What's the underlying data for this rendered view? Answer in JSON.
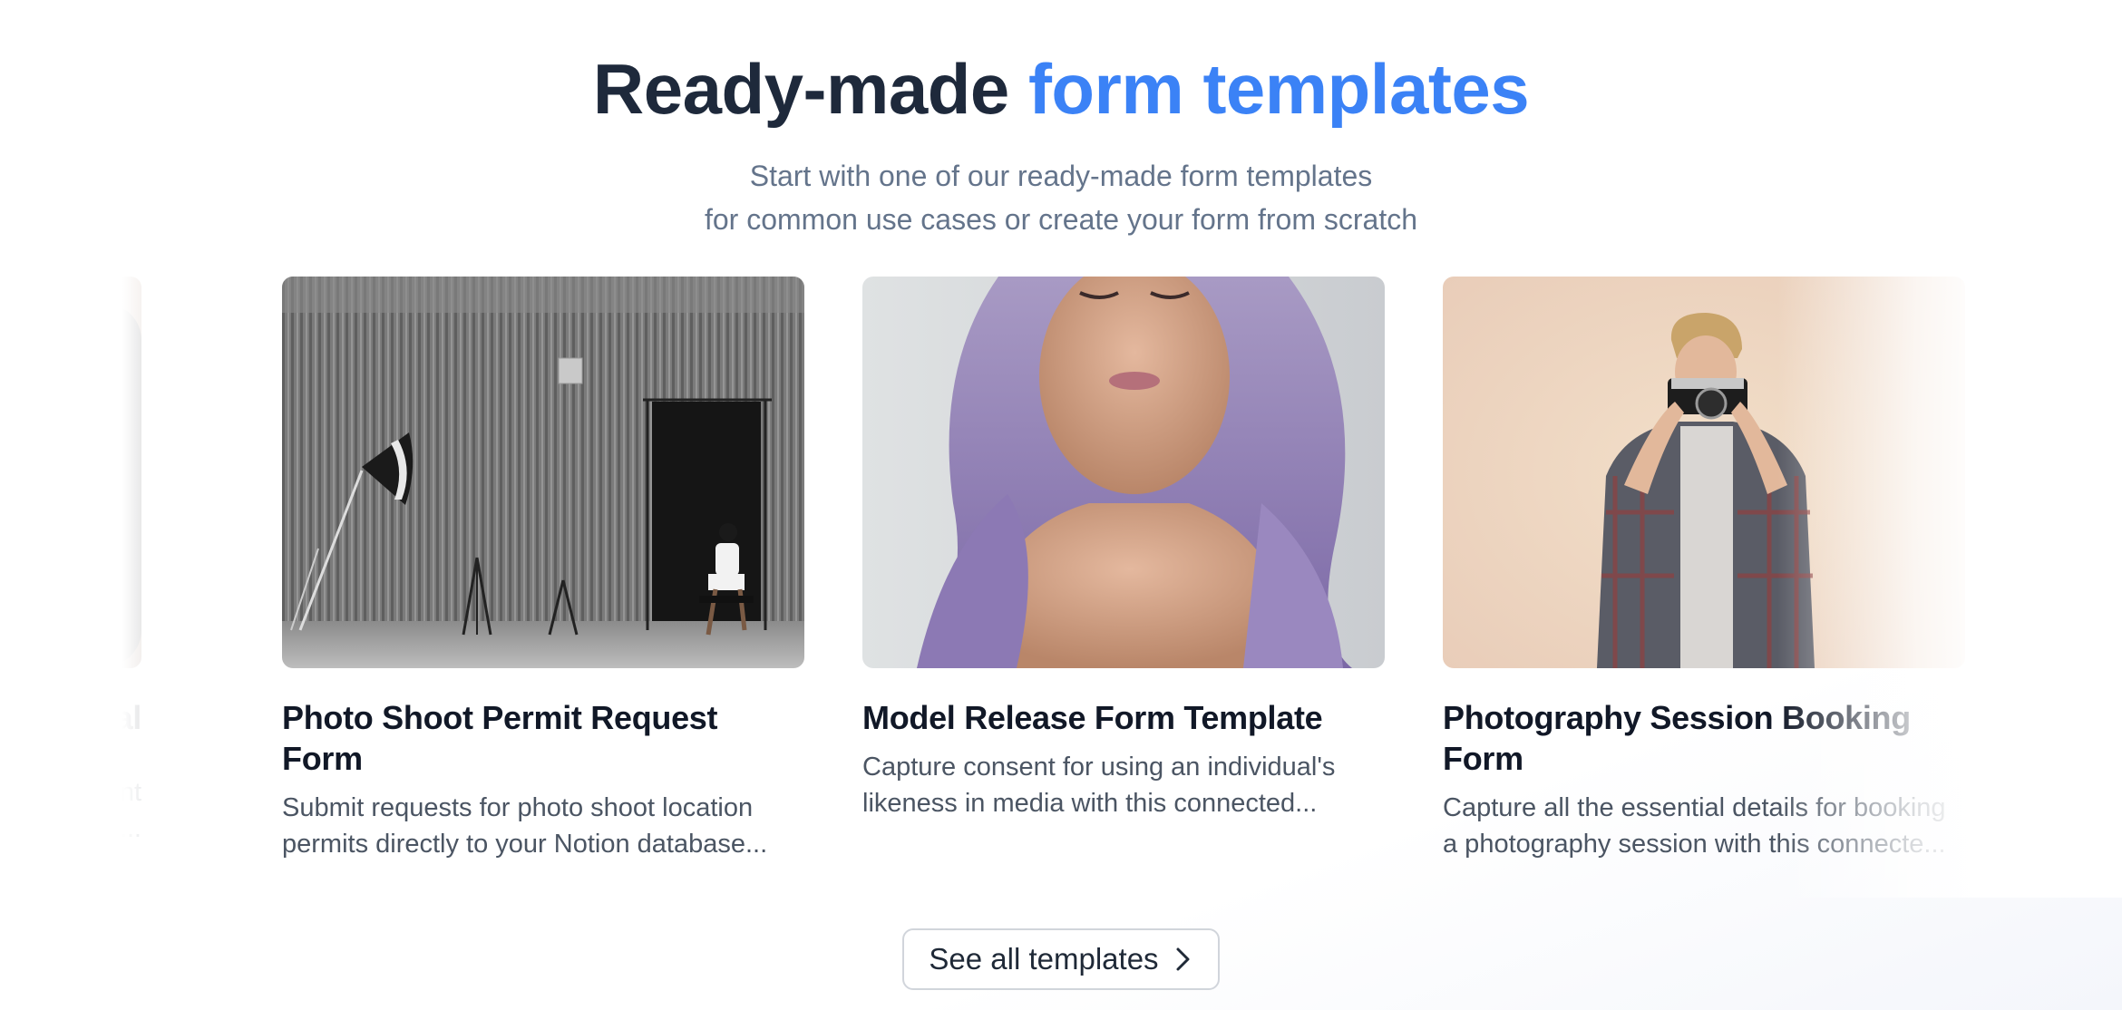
{
  "header": {
    "title_part1": "Ready-made ",
    "title_accent": "form templates",
    "subtitle_line1": "Start with one of our ready-made form templates",
    "subtitle_line2": "for common use cases or create your form from scratch"
  },
  "colors": {
    "accent": "#3b82f6",
    "heading": "#1e293b",
    "subtitle": "#64748b"
  },
  "cards": [
    {
      "title": "tal",
      "desc_line1": "nt",
      "desc_line2": "n...",
      "image": "camera-closeup"
    },
    {
      "title": "Photo Shoot Permit Request Form",
      "desc": "Submit requests for photo shoot location permits directly to your Notion database...",
      "image": "studio-wall-photo"
    },
    {
      "title": "Model Release Form Template",
      "desc": "Capture consent for using an individual's likeness in media with this connected...",
      "image": "purple-hair-portrait"
    },
    {
      "title": "Photography Session Booking Form",
      "desc": "Capture all the essential details for booking a photography session with this connecte...",
      "image": "photographer-with-camera"
    }
  ],
  "cta": {
    "label": "See all templates",
    "icon": "chevron-right-icon"
  }
}
